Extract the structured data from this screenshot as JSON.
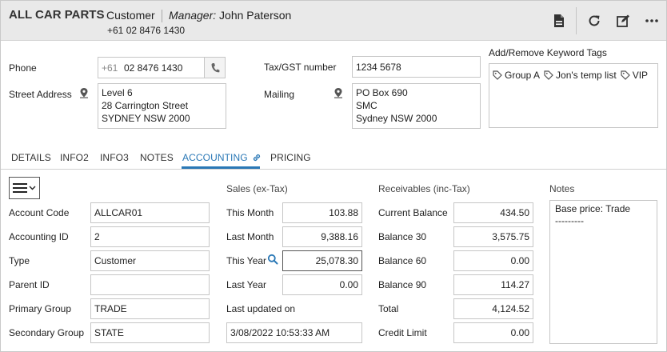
{
  "header": {
    "company": "ALL CAR PARTS",
    "role": "Customer",
    "manager_label": "Manager:",
    "manager_name": "John Paterson",
    "phone": "+61 02 8476 1430",
    "icons": [
      "document-icon",
      "refresh-icon",
      "edit-icon",
      "more-icon"
    ]
  },
  "contact": {
    "phone_label": "Phone",
    "phone_prefix": "+61",
    "phone_value": "02 8476 1430",
    "street_label": "Street Address",
    "street_lines": [
      "Level 6",
      "28 Carrington Street",
      "SYDNEY NSW 2000"
    ],
    "tax_label": "Tax/GST number",
    "tax_value": "1234 5678",
    "mailing_label": "Mailing",
    "mailing_lines": [
      "PO Box 690",
      "SMC",
      "Sydney NSW 2000"
    ],
    "tags_label": "Add/Remove Keyword Tags",
    "tags": [
      "Group A",
      "Jon's temp list",
      "VIP"
    ]
  },
  "tabs": [
    {
      "label": "DETAILS",
      "active": false
    },
    {
      "label": "INFO2",
      "active": false
    },
    {
      "label": "INFO3",
      "active": false
    },
    {
      "label": "NOTES",
      "active": false
    },
    {
      "label": "ACCOUNTING",
      "active": true
    },
    {
      "label": "PRICING",
      "active": false
    }
  ],
  "account": {
    "fields": [
      {
        "label": "Account Code",
        "value": "ALLCAR01"
      },
      {
        "label": "Accounting ID",
        "value": "2"
      },
      {
        "label": "Type",
        "value": "Customer"
      },
      {
        "label": "Parent ID",
        "value": ""
      },
      {
        "label": "Primary Group",
        "value": "TRADE"
      },
      {
        "label": "Secondary Group",
        "value": "STATE"
      }
    ]
  },
  "sales": {
    "heading": "Sales (ex-Tax)",
    "rows": [
      {
        "label": "This Month",
        "value": "103.88"
      },
      {
        "label": "Last Month",
        "value": "9,388.16"
      },
      {
        "label": "This Year",
        "value": "25,078.30"
      },
      {
        "label": "Last Year",
        "value": "0.00"
      }
    ],
    "updated_label": "Last updated on",
    "updated_value": "3/08/2022 10:53:33 AM"
  },
  "receivables": {
    "heading": "Receivables (inc-Tax)",
    "rows": [
      {
        "label": "Current Balance",
        "value": "434.50"
      },
      {
        "label": "Balance 30",
        "value": "3,575.75"
      },
      {
        "label": "Balance 60",
        "value": "0.00"
      },
      {
        "label": "Balance 90",
        "value": "114.27"
      },
      {
        "label": "Total",
        "value": "4,124.52"
      },
      {
        "label": "Credit Limit",
        "value": "0.00"
      }
    ]
  },
  "notes": {
    "heading": "Notes",
    "lines": [
      "Base price: Trade",
      "---------"
    ]
  },
  "colors": {
    "accent": "#2a78b6",
    "header_bg": "#e9e9e9"
  }
}
